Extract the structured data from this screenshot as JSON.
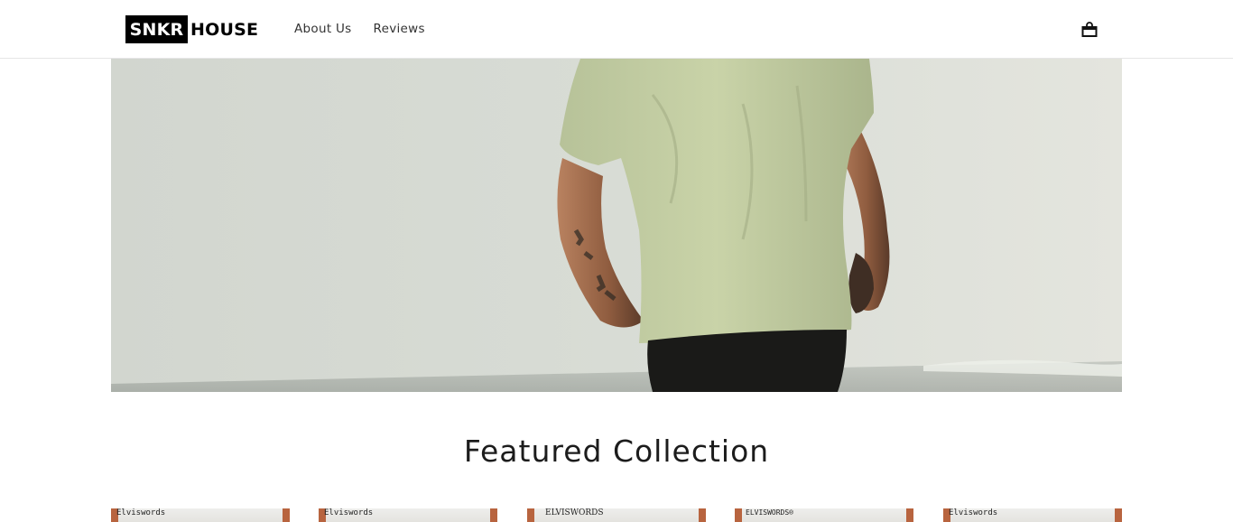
{
  "header": {
    "logo_boxed": "SNKR",
    "logo_rest": "HOUSE",
    "nav": [
      {
        "label": "About Us"
      },
      {
        "label": "Reviews"
      }
    ],
    "cart_icon": "shopping-bag-icon"
  },
  "hero": {
    "image": "man-in-green-tshirt-beach-photo"
  },
  "featured": {
    "title": "Featured Collection",
    "products": [
      {
        "brand": "Elviswords"
      },
      {
        "brand": "Elviswords"
      },
      {
        "brand": "ELVISWORDS"
      },
      {
        "brand": "ELVISWORDS®"
      },
      {
        "brand": "Elviswords"
      }
    ]
  },
  "colors": {
    "accent": "#000000",
    "text": "#1c1c1c",
    "border": "#e6e6e6"
  }
}
